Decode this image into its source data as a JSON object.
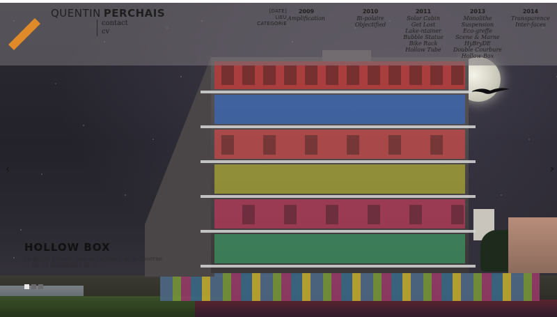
{
  "site": {
    "first_name": "QUENTIN",
    "last_name": "PERCHAIS",
    "nav": [
      "contact",
      "cv"
    ]
  },
  "sort": [
    "[DATE]",
    "LIEU",
    "CATEGORIE"
  ],
  "years": [
    {
      "year": "2009",
      "projects": [
        "Amplification"
      ]
    },
    {
      "year": "2010",
      "projects": [
        "Bi-polaire",
        "Objectified"
      ]
    },
    {
      "year": "2011",
      "projects": [
        "Solar Cabin",
        "Get Lost",
        "Lake-ntainer",
        "Bubble Statue",
        "Bike Rack",
        "Hollow Tube"
      ]
    },
    {
      "year": "2013",
      "projects": [
        "Monolithe",
        "Suspension",
        "Eco-greffe",
        "Scene & Marne",
        "HyBryDE",
        "Double Courbure",
        "Hollow-Box"
      ]
    },
    {
      "year": "2014",
      "projects": [
        "Transparence",
        "Inter-faces"
      ]
    }
  ],
  "slide": {
    "title": "HOLLOW BOX",
    "text": "Le projet s'insert dans le batiment de la Caserne ... en cet abandonné et re...",
    "dots": 3,
    "active_dot": 0
  },
  "arrows": {
    "prev": "‹",
    "next": "›"
  },
  "colors": {
    "header_band": "#78737a",
    "text": "#1f1f1f",
    "logo_accent": "#e08a2a"
  }
}
